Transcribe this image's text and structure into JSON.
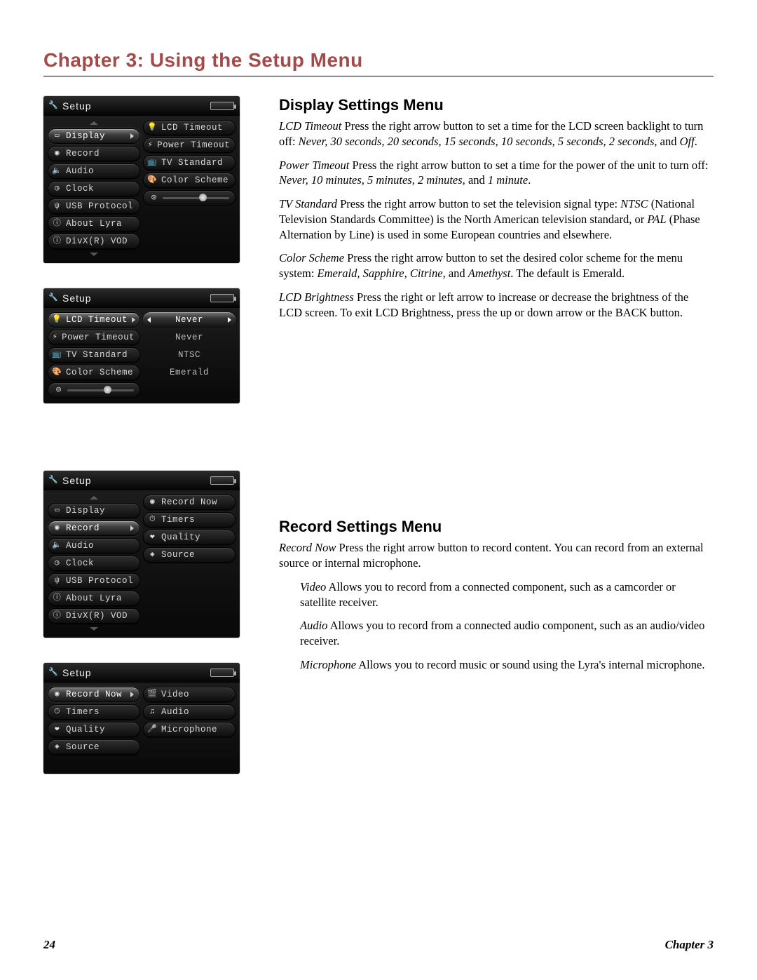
{
  "chapter_title": "Chapter 3: Using the Setup Menu",
  "footer": {
    "page": "24",
    "right": "Chapter 3"
  },
  "setup_label": "Setup",
  "screens": {
    "s1": {
      "left": [
        {
          "icon": "display",
          "label": "Display",
          "sel": true,
          "chev": true
        },
        {
          "icon": "record",
          "label": "Record"
        },
        {
          "icon": "audio",
          "label": "Audio"
        },
        {
          "icon": "clock",
          "label": "Clock"
        },
        {
          "icon": "usb",
          "label": "USB Protocol"
        },
        {
          "icon": "info",
          "label": "About Lyra"
        },
        {
          "icon": "info",
          "label": "DivX(R) VOD"
        }
      ],
      "right": [
        {
          "icon": "timeout",
          "label": "LCD Timeout"
        },
        {
          "icon": "power",
          "label": "Power Timeout"
        },
        {
          "icon": "tv",
          "label": "TV Standard"
        },
        {
          "icon": "palette",
          "label": "Color Scheme"
        },
        {
          "type": "slider",
          "icon": "lcd",
          "knob": 0.55
        }
      ]
    },
    "s2": {
      "left": [
        {
          "icon": "timeout",
          "label": "LCD Timeout",
          "sel": true,
          "chev": true
        },
        {
          "icon": "power",
          "label": "Power Timeout"
        },
        {
          "icon": "tv",
          "label": "TV Standard"
        },
        {
          "icon": "palette",
          "label": "Color Scheme"
        },
        {
          "type": "slider",
          "icon": "lcd",
          "knob": 0.55
        }
      ],
      "right_values": [
        {
          "value": "Never",
          "sel": true
        },
        {
          "value": "Never"
        },
        {
          "value": "NTSC"
        },
        {
          "value": "Emerald"
        }
      ]
    },
    "s3": {
      "left": [
        {
          "icon": "display",
          "label": "Display"
        },
        {
          "icon": "record",
          "label": "Record",
          "sel": true,
          "chev": true
        },
        {
          "icon": "audio",
          "label": "Audio"
        },
        {
          "icon": "clock",
          "label": "Clock"
        },
        {
          "icon": "usb",
          "label": "USB Protocol"
        },
        {
          "icon": "info",
          "label": "About Lyra"
        },
        {
          "icon": "info",
          "label": "DivX(R) VOD"
        }
      ],
      "right": [
        {
          "icon": "record",
          "label": "Record Now"
        },
        {
          "icon": "timer",
          "label": "Timers"
        },
        {
          "icon": "quality",
          "label": "Quality"
        },
        {
          "icon": "source",
          "label": "Source"
        }
      ]
    },
    "s4": {
      "left": [
        {
          "icon": "record",
          "label": "Record Now",
          "sel": true,
          "chev": true
        },
        {
          "icon": "timer",
          "label": "Timers"
        },
        {
          "icon": "quality",
          "label": "Quality"
        },
        {
          "icon": "source",
          "label": "Source"
        }
      ],
      "right": [
        {
          "icon": "video",
          "label": "Video"
        },
        {
          "icon": "audionote",
          "label": "Audio"
        },
        {
          "icon": "mic",
          "label": "Microphone"
        }
      ]
    }
  },
  "sections": {
    "display": {
      "heading": "Display Settings Menu",
      "paras": [
        {
          "term": "LCD Timeout",
          "body": "    Press the right arrow button to set a time for the LCD screen backlight to turn off: ",
          "tail_em": "Never, 30 seconds, 20 seconds, 15 seconds, 10 seconds, 5 seconds, 2 seconds,",
          "tail_plain": " and ",
          "tail_em2": "Off",
          "tail_plain2": "."
        },
        {
          "term": "Power Timeout",
          "body": "    Press the right arrow button to set a time for the power of the unit to turn off: ",
          "tail_em": "Never, 10 minutes, 5 minutes, 2 minutes,",
          "tail_plain": " and ",
          "tail_em2": "1 minute",
          "tail_plain2": "."
        },
        {
          "term": "TV Standard",
          "body": "    Press the right arrow button to set the television signal type: ",
          "tail_em": "NTSC",
          "tail_plain": " (National Television Standards Committee) is the North American television standard, or ",
          "tail_em2": "PAL",
          "tail_plain2": " (Phase Alternation by Line) is used in some European countries and elsewhere."
        },
        {
          "term": "Color Scheme",
          "body": "   Press the right arrow button to set the desired color scheme for the menu system: ",
          "tail_em": "Emerald, Sapphire, Citrine,",
          "tail_plain": " and ",
          "tail_em2": "Amethyst",
          "tail_plain2": ". The default is Emerald."
        },
        {
          "term": "LCD Brightness",
          "body": "    Press the right or left arrow to increase or decrease the brightness of the LCD screen. To exit LCD Brightness, press the up or down arrow or the BACK button."
        }
      ]
    },
    "record": {
      "heading": "Record Settings Menu",
      "intro": {
        "term": "Record Now",
        "body": "    Press the right arrow button to record content. You can record from an external source or internal microphone."
      },
      "subs": [
        {
          "term": "Video",
          "body": "   Allows you to record from a connected component, such as a camcorder or satellite receiver."
        },
        {
          "term": "Audio",
          "body": "   Allows you to record from a connected audio component, such as an audio/video receiver."
        },
        {
          "term": "Microphone",
          "body": "  Allows you to record music or sound using the Lyra's internal microphone."
        }
      ]
    }
  },
  "icon_glyphs": {
    "display": "▭",
    "record": "◉",
    "audio": "🔈",
    "clock": "◷",
    "usb": "ψ",
    "info": "ⓘ",
    "timeout": "💡",
    "power": "⚡",
    "tv": "📺",
    "palette": "🎨",
    "lcd": "◎",
    "timer": "⏱",
    "quality": "❤",
    "source": "◈",
    "video": "🎬",
    "audionote": "♫",
    "mic": "🎤",
    "wrench": "🔧"
  }
}
